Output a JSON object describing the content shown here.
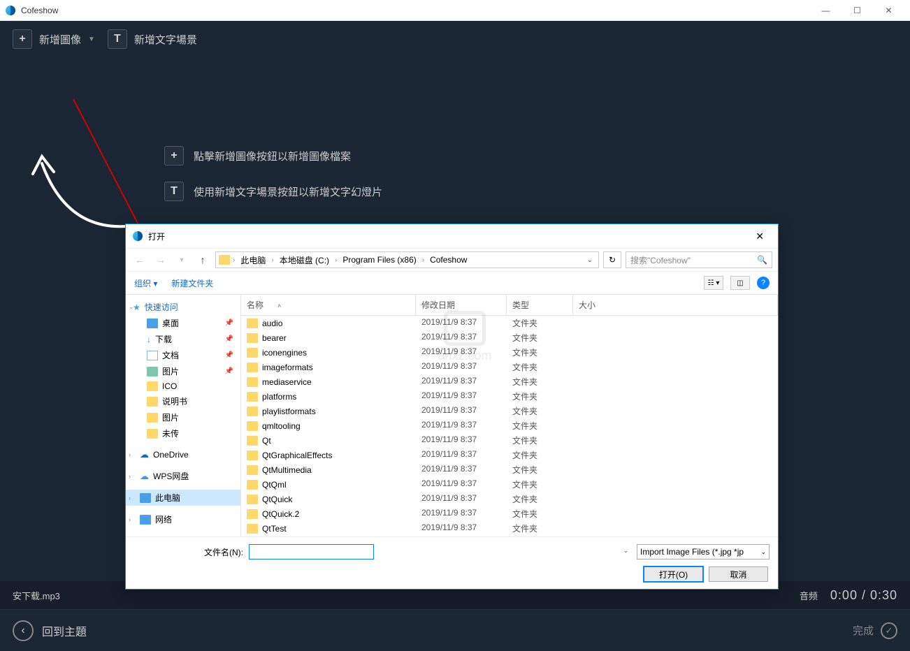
{
  "app": {
    "title": "Cofeshow"
  },
  "toolbar": {
    "add_image": "新增圖像",
    "add_text": "新增文字場景"
  },
  "hints": {
    "image": "點擊新增圖像按鈕以新增圖像檔案",
    "text": "使用新增文字場景按鈕以新增文字幻燈片"
  },
  "bottom": {
    "audio_file": "安下载.mp3",
    "audio_label": "音频",
    "time": "0:00 / 0:30"
  },
  "footer": {
    "back": "回到主題",
    "done": "完成"
  },
  "dialog": {
    "title": "打开",
    "breadcrumb": [
      "此电脑",
      "本地磁盘 (C:)",
      "Program Files (x86)",
      "Cofeshow"
    ],
    "search_placeholder": "搜索\"Cofeshow\"",
    "organize": "组织",
    "new_folder": "新建文件夹",
    "columns": {
      "name": "名称",
      "date": "修改日期",
      "type": "类型",
      "size": "大小"
    },
    "sidebar": {
      "quick": "快速访问",
      "quick_items": [
        {
          "label": "桌面",
          "icon": "ico-desktop",
          "pinned": true
        },
        {
          "label": "下载",
          "icon": "ico-download",
          "pinned": true,
          "glyph": "↓"
        },
        {
          "label": "文档",
          "icon": "ico-doc",
          "pinned": true
        },
        {
          "label": "图片",
          "icon": "ico-pic",
          "pinned": true
        },
        {
          "label": "ICO",
          "icon": "ico-folder"
        },
        {
          "label": "说明书",
          "icon": "ico-folder"
        },
        {
          "label": "图片",
          "icon": "ico-folder"
        },
        {
          "label": "未传",
          "icon": "ico-folder"
        }
      ],
      "onedrive": "OneDrive",
      "wps": "WPS网盘",
      "thispc": "此电脑",
      "network": "网络"
    },
    "files": [
      {
        "name": "audio",
        "date": "2019/11/9 8:37",
        "type": "文件夹"
      },
      {
        "name": "bearer",
        "date": "2019/11/9 8:37",
        "type": "文件夹"
      },
      {
        "name": "iconengines",
        "date": "2019/11/9 8:37",
        "type": "文件夹"
      },
      {
        "name": "imageformats",
        "date": "2019/11/9 8:37",
        "type": "文件夹"
      },
      {
        "name": "mediaservice",
        "date": "2019/11/9 8:37",
        "type": "文件夹"
      },
      {
        "name": "platforms",
        "date": "2019/11/9 8:37",
        "type": "文件夹"
      },
      {
        "name": "playlistformats",
        "date": "2019/11/9 8:37",
        "type": "文件夹"
      },
      {
        "name": "qmltooling",
        "date": "2019/11/9 8:37",
        "type": "文件夹"
      },
      {
        "name": "Qt",
        "date": "2019/11/9 8:37",
        "type": "文件夹"
      },
      {
        "name": "QtGraphicalEffects",
        "date": "2019/11/9 8:37",
        "type": "文件夹"
      },
      {
        "name": "QtMultimedia",
        "date": "2019/11/9 8:37",
        "type": "文件夹"
      },
      {
        "name": "QtQml",
        "date": "2019/11/9 8:37",
        "type": "文件夹"
      },
      {
        "name": "QtQuick",
        "date": "2019/11/9 8:37",
        "type": "文件夹"
      },
      {
        "name": "QtQuick.2",
        "date": "2019/11/9 8:37",
        "type": "文件夹"
      },
      {
        "name": "QtTest",
        "date": "2019/11/9 8:37",
        "type": "文件夹"
      }
    ],
    "filename_label": "文件名(N):",
    "filter": "Import Image Files (*.jpg *jp",
    "open_btn": "打开(O)",
    "cancel_btn": "取消",
    "watermark": "anxz.com"
  }
}
